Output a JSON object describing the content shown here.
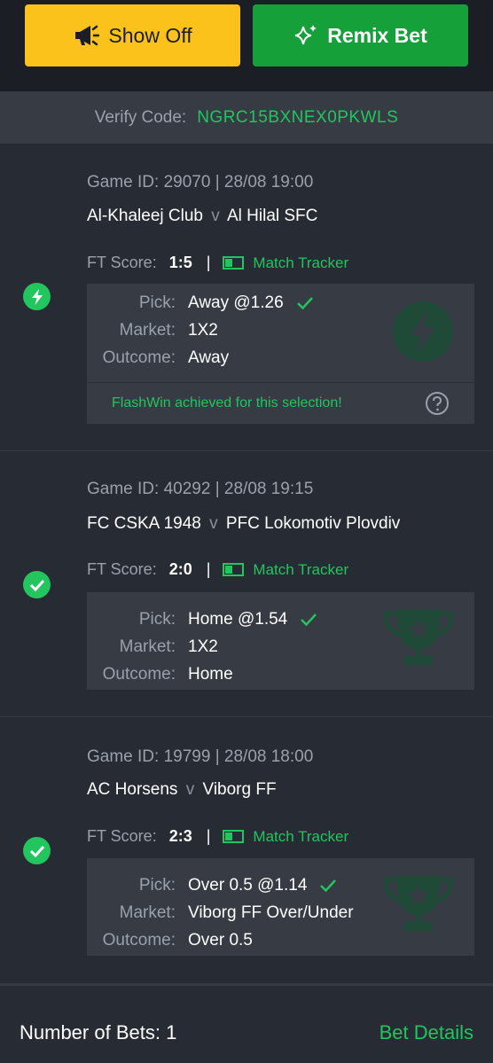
{
  "header": {
    "show_off_label": "Show Off",
    "remix_bet_label": "Remix Bet"
  },
  "verify": {
    "label": "Verify Code:",
    "code": "NGRC15BXNEX0PKWLS"
  },
  "bets": [
    {
      "status": "flashwin",
      "game_id": "Game ID: 29070 | 28/08 19:00",
      "home": "Al-Khaleej Club",
      "vs": "v",
      "away": "Al Hilal SFC",
      "ft_label": "FT Score:",
      "ft_score": "1:5",
      "separator": "|",
      "tracker_label": "Match Tracker",
      "pick_label": "Pick:",
      "pick": "Away @1.26",
      "market_label": "Market:",
      "market": "1X2",
      "outcome_label": "Outcome:",
      "outcome": "Away",
      "flashwin_text": "FlashWin achieved for this selection!"
    },
    {
      "status": "won",
      "game_id": "Game ID: 40292 | 28/08 19:15",
      "home": "FC CSKA 1948",
      "vs": "v",
      "away": "PFC Lokomotiv Plovdiv",
      "ft_label": "FT Score:",
      "ft_score": "2:0",
      "separator": "|",
      "tracker_label": "Match Tracker",
      "pick_label": "Pick:",
      "pick": "Home @1.54",
      "market_label": "Market:",
      "market": "1X2",
      "outcome_label": "Outcome:",
      "outcome": "Home"
    },
    {
      "status": "won",
      "game_id": "Game ID: 19799 | 28/08 18:00",
      "home": "AC Horsens",
      "vs": "v",
      "away": "Viborg FF",
      "ft_label": "FT Score:",
      "ft_score": "2:3",
      "separator": "|",
      "tracker_label": "Match Tracker",
      "pick_label": "Pick:",
      "pick": "Over 0.5 @1.14",
      "market_label": "Market:",
      "market": "Viborg FF Over/Under",
      "outcome_label": "Outcome:",
      "outcome": "Over 0.5"
    }
  ],
  "footer": {
    "number_of_bets": "Number of Bets: 1",
    "bet_details_label": "Bet Details"
  },
  "colors": {
    "accent_green": "#22c55e",
    "show_off_yellow": "#fbc21b",
    "remix_green": "#16a03a",
    "background": "#272b33"
  },
  "icons": [
    "megaphone-icon",
    "sparkle-icon",
    "lightning-icon",
    "check-circle-icon",
    "check-icon",
    "match-tracker-icon",
    "lightning-watermark-icon",
    "trophy-watermark-icon",
    "help-icon"
  ]
}
